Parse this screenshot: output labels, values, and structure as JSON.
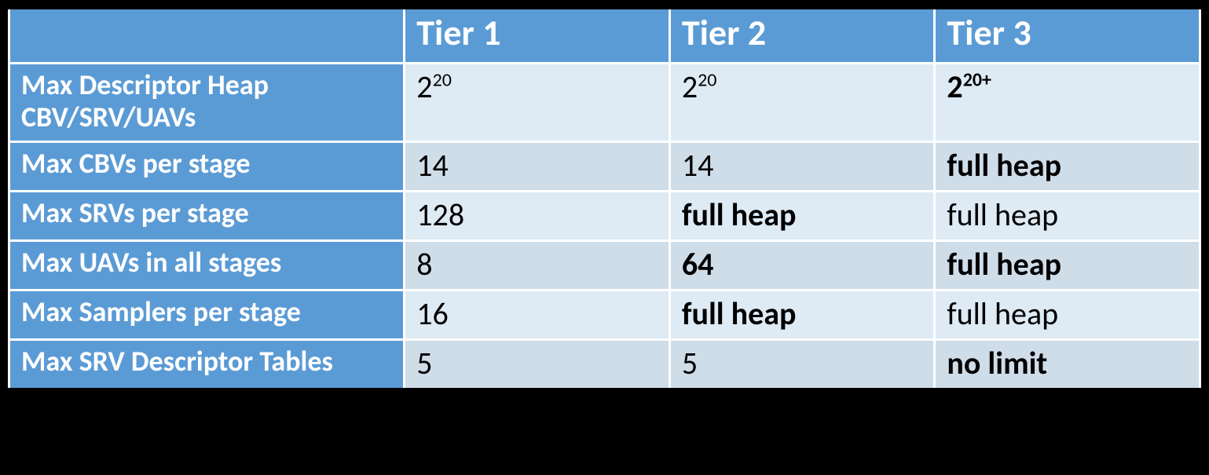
{
  "chart_data": {
    "type": "table",
    "columns": [
      "",
      "Tier 1",
      "Tier 2",
      "Tier 3"
    ],
    "rows": [
      {
        "label": "Max Descriptor Heap CBV/SRV/UAVs",
        "tier1": "2^20",
        "tier2": "2^20",
        "tier3": "2^20+"
      },
      {
        "label": "Max CBVs per stage",
        "tier1": "14",
        "tier2": "14",
        "tier3": "full heap"
      },
      {
        "label": "Max SRVs per stage",
        "tier1": "128",
        "tier2": "full heap",
        "tier3": "full heap"
      },
      {
        "label": "Max UAVs in all stages",
        "tier1": "8",
        "tier2": "64",
        "tier3": "full heap"
      },
      {
        "label": "Max Samplers per stage",
        "tier1": "16",
        "tier2": "full heap",
        "tier3": "full heap"
      },
      {
        "label": "Max SRV Descriptor Tables",
        "tier1": "5",
        "tier2": "5",
        "tier3": "no limit"
      }
    ]
  },
  "head": {
    "c0": "",
    "c1": "Tier 1",
    "c2": "Tier 2",
    "c3": "Tier 3"
  },
  "r0": {
    "label_a": "Max Descriptor Heap",
    "label_b": "CBV/SRV/UAVs",
    "t1_base": "2",
    "t1_sup": "20",
    "t2_base": "2",
    "t2_sup": "20",
    "t3_base": "2",
    "t3_sup": "20+"
  },
  "r1": {
    "label": "Max CBVs per stage",
    "t1": "14",
    "t2": "14",
    "t3": "full heap"
  },
  "r2": {
    "label": "Max SRVs per stage",
    "t1": "128",
    "t2": "full heap",
    "t3": "full heap"
  },
  "r3": {
    "label": "Max UAVs in all stages",
    "t1": "8",
    "t2": "64",
    "t3": "full heap"
  },
  "r4": {
    "label": "Max Samplers per stage",
    "t1": "16",
    "t2": "full heap",
    "t3": "full heap"
  },
  "r5": {
    "label": "Max SRV Descriptor Tables",
    "t1": "5",
    "t2": "5",
    "t3": "no limit"
  }
}
